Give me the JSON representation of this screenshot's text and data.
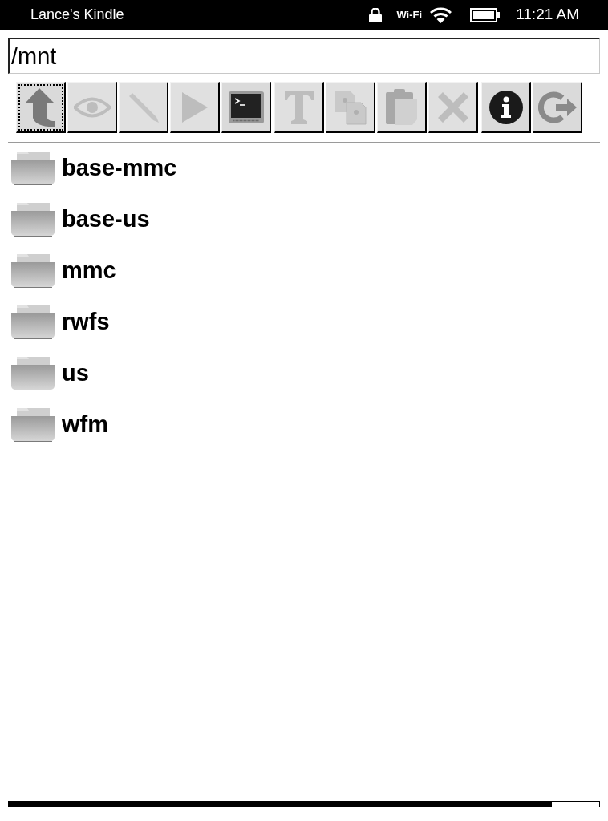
{
  "status_bar": {
    "device_name": "Lance's Kindle",
    "wifi_label": "Wi-Fi",
    "time": "11:21 AM"
  },
  "path_field": {
    "value": "/mnt"
  },
  "toolbar": {
    "groups": [
      {
        "buttons": [
          {
            "kind": "up",
            "disabled": false,
            "focused": true
          },
          {
            "kind": "view",
            "disabled": true,
            "focused": false
          },
          {
            "kind": "edit",
            "disabled": true,
            "focused": false
          },
          {
            "kind": "run",
            "disabled": true,
            "focused": false
          },
          {
            "kind": "terminal",
            "disabled": false,
            "focused": false
          }
        ]
      },
      {
        "buttons": [
          {
            "kind": "rename",
            "disabled": true,
            "focused": false
          },
          {
            "kind": "copy",
            "disabled": true,
            "focused": false
          },
          {
            "kind": "paste",
            "disabled": true,
            "focused": false
          },
          {
            "kind": "delete",
            "disabled": true,
            "focused": false
          }
        ]
      },
      {
        "buttons": [
          {
            "kind": "info",
            "disabled": false,
            "focused": false
          },
          {
            "kind": "exit",
            "disabled": false,
            "focused": false
          }
        ]
      }
    ]
  },
  "files": [
    {
      "name": "base-mmc"
    },
    {
      "name": "base-us"
    },
    {
      "name": "mmc"
    },
    {
      "name": "rwfs"
    },
    {
      "name": "us"
    },
    {
      "name": "wfm"
    }
  ],
  "reading_progress": {
    "level": 0.92
  }
}
